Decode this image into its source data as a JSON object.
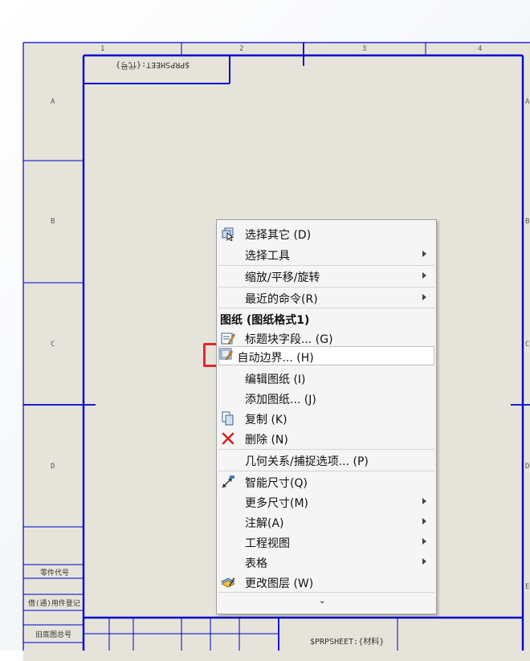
{
  "drawing": {
    "col_labels": [
      "1",
      "2",
      "3",
      "4"
    ],
    "row_labels": [
      "A",
      "B",
      "C",
      "D"
    ],
    "right_row_labels": [
      "A",
      "B",
      "C",
      "D",
      "E"
    ],
    "top_mirrored_text": "$PRPSHEET:{代号}",
    "left_block_labels": [
      "零件代号",
      "借(通)用件登记",
      "旧底图总号"
    ],
    "bottom_text": "$PRPSHEET:{材料}",
    "colors": {
      "sheet_bg": "#e6e4da",
      "border_line": "#0000cc",
      "highlight_box": "#e0282a"
    }
  },
  "context_menu": {
    "items": [
      {
        "label": "选择其它 (D)",
        "icon": "select-other-icon",
        "submenu": false
      },
      {
        "label": "选择工具",
        "submenu": true
      },
      {
        "label": "缩放/平移/旋转",
        "submenu": true
      },
      {
        "label": "最近的命令(R)",
        "submenu": true
      }
    ],
    "section_header": "图纸 (图纸格式1)",
    "sheet_items": [
      {
        "label": "标题块字段... (G)",
        "icon": "title-block-icon"
      },
      {
        "label": "自动边界... (H)",
        "icon": "auto-border-icon",
        "highlighted": true
      },
      {
        "label": "编辑图纸 (I)"
      },
      {
        "label": "添加图纸... (J)"
      },
      {
        "label": "复制 (K)",
        "icon": "copy-icon"
      },
      {
        "label": "删除 (N)",
        "icon": "delete-icon"
      }
    ],
    "relation_item": "几何关系/捕捉选项... (P)",
    "dim_items": [
      {
        "label": "智能尺寸(Q)",
        "icon": "smart-dimension-icon",
        "submenu": false
      },
      {
        "label": "更多尺寸(M)",
        "submenu": true
      },
      {
        "label": "注解(A)",
        "submenu": true
      },
      {
        "label": "工程视图",
        "submenu": true
      },
      {
        "label": "表格",
        "submenu": true
      },
      {
        "label": "更改图层 (W)",
        "icon": "change-layer-icon",
        "submenu": false
      }
    ],
    "more_indicator": "⌄"
  }
}
